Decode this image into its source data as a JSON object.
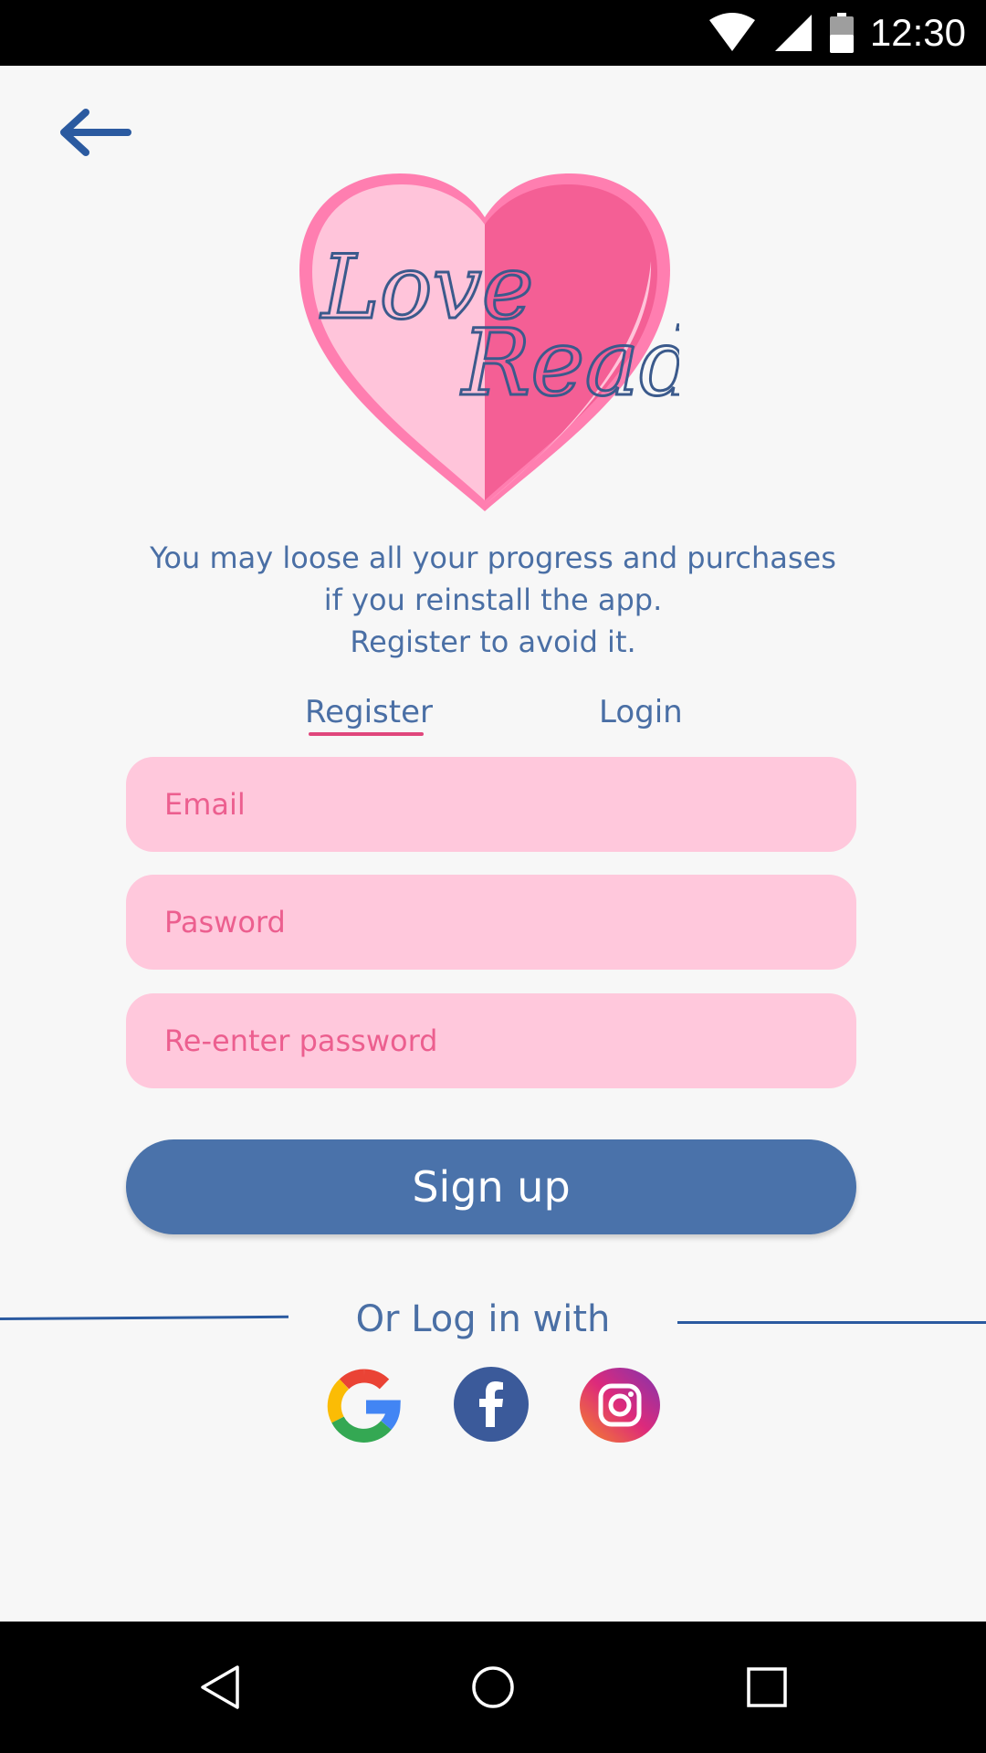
{
  "status_bar": {
    "time": "12:30",
    "icons": [
      "wifi-icon",
      "signal-icon",
      "battery-icon"
    ]
  },
  "header": {
    "back_icon": "arrow-left-icon"
  },
  "logo": {
    "line1": "Love",
    "line2": "Read",
    "colors": {
      "light": "#ffc4da",
      "dark": "#f45f95",
      "text": "#3b5a8c"
    }
  },
  "warning": {
    "line1": "You may loose all your progress and purchases",
    "line2": "if you reinstall the app.",
    "line3": "Register to avoid it."
  },
  "tabs": {
    "register": "Register",
    "login": "Login",
    "active": "register"
  },
  "form": {
    "email_placeholder": "Email",
    "password_placeholder": "Pasword",
    "reenter_placeholder": "Re-enter password",
    "submit_label": "Sign up"
  },
  "social": {
    "label": "Or Log in with",
    "providers": [
      "google-icon",
      "facebook-icon",
      "instagram-icon"
    ]
  },
  "colors": {
    "primary": "#4a72aa",
    "text": "#4a6fa5",
    "field_bg": "#ffc8dc",
    "accent": "#e0477c"
  }
}
